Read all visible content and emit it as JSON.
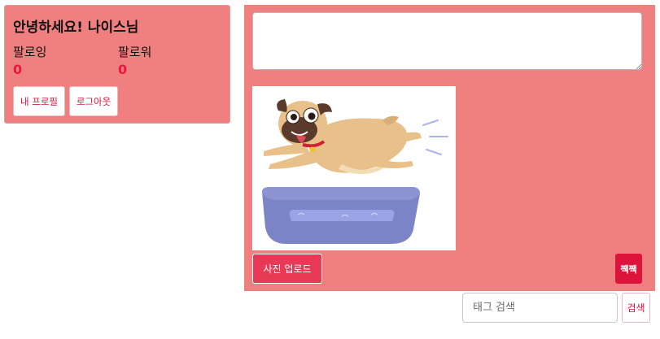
{
  "profile": {
    "greeting": "안녕하세요! 나이스님",
    "following_label": "팔로잉",
    "following_count": "0",
    "followers_label": "팔로워",
    "followers_count": "0",
    "my_profile_label": "내 프로필",
    "logout_label": "로그아웃"
  },
  "post_form": {
    "content_value": "",
    "upload_label": "사진 업로드",
    "submit_label": "짹짹",
    "preview_image": "pug-jumping-into-dog-bed"
  },
  "tag_search": {
    "placeholder": "태그 검색",
    "value": "",
    "button_label": "검색"
  },
  "colors": {
    "panel_bg": "#f08080",
    "accent": "#dc143c",
    "count": "#e8183f"
  }
}
